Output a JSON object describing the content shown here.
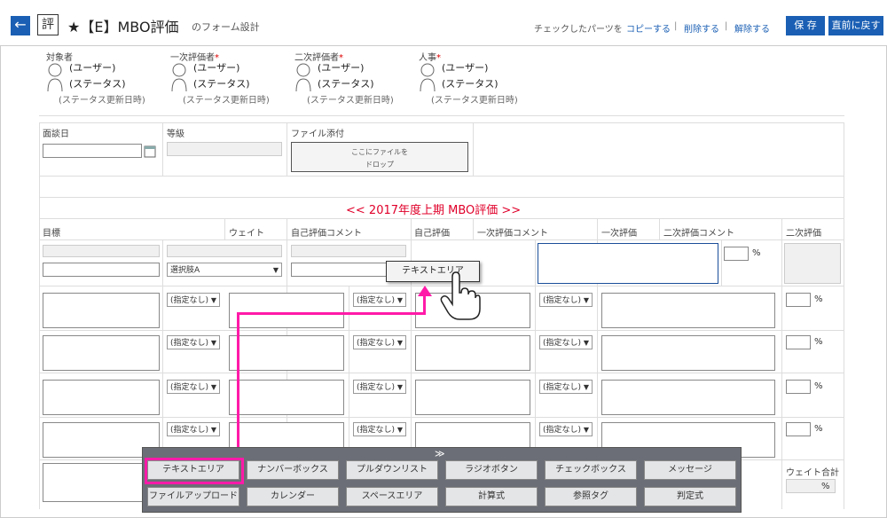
{
  "header": {
    "back_icon": "left-arrow-icon",
    "badge": "評",
    "title": "★【E】MBO評価",
    "subtitle": "のフォーム設計",
    "hint": "チェックしたパーツを",
    "copy": "コピーする",
    "delete": "削除する",
    "release": "解除する",
    "sep": "|",
    "save": "保 存",
    "return": "直前に戻す"
  },
  "evaluators": [
    {
      "label": "対象者",
      "required": "",
      "user": "(ユーザー)",
      "status": "(ステータス)",
      "updated": "(ステータス更新日時)"
    },
    {
      "label": "一次評価者",
      "required": "*",
      "user": "(ユーザー)",
      "status": "(ステータス)",
      "updated": "(ステータス更新日時)"
    },
    {
      "label": "二次評価者",
      "required": "*",
      "user": "(ユーザー)",
      "status": "(ステータス)",
      "updated": "(ステータス更新日時)"
    },
    {
      "label": "人事",
      "required": "*",
      "user": "(ユーザー)",
      "status": "(ステータス)",
      "updated": "(ステータス更新日時)"
    }
  ],
  "form": {
    "interview_date": "面談日",
    "grade": "等級",
    "file_attach": "ファイル添付",
    "drop_line1": "ここにファイルを",
    "drop_line2": "ドロップ",
    "section_title": "<< 2017年度上期 MBO評価 >>"
  },
  "columns": [
    "目標",
    "ウェイト",
    "自己評価コメント",
    "自己評価",
    "一次評価コメント",
    "一次評価",
    "二次評価コメント",
    "二次評価"
  ],
  "select_a": "選択肢A",
  "select_none": "(指定なし)",
  "pct": "%",
  "weight_total": "ウェイト合計",
  "tooltip": "テキストエリア",
  "palette": {
    "row1": [
      "テキストエリア",
      "ナンバーボックス",
      "プルダウンリスト",
      "ラジオボタン",
      "チェックボックス",
      "メッセージ"
    ],
    "row2": [
      "ファイルアップロード",
      "カレンダー",
      "スペースエリア",
      "計算式",
      "参照タグ",
      "判定式"
    ]
  },
  "colors": {
    "accent": "#1a5fb4",
    "highlight": "#ff1aa8",
    "section": "#e0002a"
  }
}
